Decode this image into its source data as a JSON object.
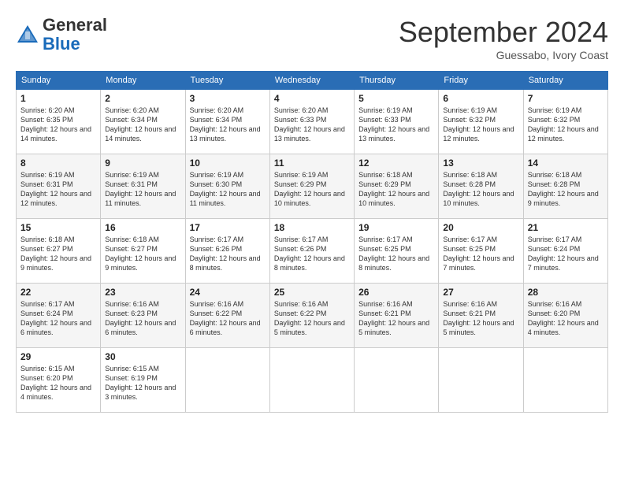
{
  "header": {
    "logo_general": "General",
    "logo_blue": "Blue",
    "month_title": "September 2024",
    "location": "Guessabo, Ivory Coast"
  },
  "days_of_week": [
    "Sunday",
    "Monday",
    "Tuesday",
    "Wednesday",
    "Thursday",
    "Friday",
    "Saturday"
  ],
  "weeks": [
    [
      {
        "day": "1",
        "sunrise": "6:20 AM",
        "sunset": "6:35 PM",
        "daylight": "12 hours and 14 minutes."
      },
      {
        "day": "2",
        "sunrise": "6:20 AM",
        "sunset": "6:34 PM",
        "daylight": "12 hours and 14 minutes."
      },
      {
        "day": "3",
        "sunrise": "6:20 AM",
        "sunset": "6:34 PM",
        "daylight": "12 hours and 13 minutes."
      },
      {
        "day": "4",
        "sunrise": "6:20 AM",
        "sunset": "6:33 PM",
        "daylight": "12 hours and 13 minutes."
      },
      {
        "day": "5",
        "sunrise": "6:19 AM",
        "sunset": "6:33 PM",
        "daylight": "12 hours and 13 minutes."
      },
      {
        "day": "6",
        "sunrise": "6:19 AM",
        "sunset": "6:32 PM",
        "daylight": "12 hours and 12 minutes."
      },
      {
        "day": "7",
        "sunrise": "6:19 AM",
        "sunset": "6:32 PM",
        "daylight": "12 hours and 12 minutes."
      }
    ],
    [
      {
        "day": "8",
        "sunrise": "6:19 AM",
        "sunset": "6:31 PM",
        "daylight": "12 hours and 12 minutes."
      },
      {
        "day": "9",
        "sunrise": "6:19 AM",
        "sunset": "6:31 PM",
        "daylight": "12 hours and 11 minutes."
      },
      {
        "day": "10",
        "sunrise": "6:19 AM",
        "sunset": "6:30 PM",
        "daylight": "12 hours and 11 minutes."
      },
      {
        "day": "11",
        "sunrise": "6:19 AM",
        "sunset": "6:29 PM",
        "daylight": "12 hours and 10 minutes."
      },
      {
        "day": "12",
        "sunrise": "6:18 AM",
        "sunset": "6:29 PM",
        "daylight": "12 hours and 10 minutes."
      },
      {
        "day": "13",
        "sunrise": "6:18 AM",
        "sunset": "6:28 PM",
        "daylight": "12 hours and 10 minutes."
      },
      {
        "day": "14",
        "sunrise": "6:18 AM",
        "sunset": "6:28 PM",
        "daylight": "12 hours and 9 minutes."
      }
    ],
    [
      {
        "day": "15",
        "sunrise": "6:18 AM",
        "sunset": "6:27 PM",
        "daylight": "12 hours and 9 minutes."
      },
      {
        "day": "16",
        "sunrise": "6:18 AM",
        "sunset": "6:27 PM",
        "daylight": "12 hours and 9 minutes."
      },
      {
        "day": "17",
        "sunrise": "6:17 AM",
        "sunset": "6:26 PM",
        "daylight": "12 hours and 8 minutes."
      },
      {
        "day": "18",
        "sunrise": "6:17 AM",
        "sunset": "6:26 PM",
        "daylight": "12 hours and 8 minutes."
      },
      {
        "day": "19",
        "sunrise": "6:17 AM",
        "sunset": "6:25 PM",
        "daylight": "12 hours and 8 minutes."
      },
      {
        "day": "20",
        "sunrise": "6:17 AM",
        "sunset": "6:25 PM",
        "daylight": "12 hours and 7 minutes."
      },
      {
        "day": "21",
        "sunrise": "6:17 AM",
        "sunset": "6:24 PM",
        "daylight": "12 hours and 7 minutes."
      }
    ],
    [
      {
        "day": "22",
        "sunrise": "6:17 AM",
        "sunset": "6:24 PM",
        "daylight": "12 hours and 6 minutes."
      },
      {
        "day": "23",
        "sunrise": "6:16 AM",
        "sunset": "6:23 PM",
        "daylight": "12 hours and 6 minutes."
      },
      {
        "day": "24",
        "sunrise": "6:16 AM",
        "sunset": "6:22 PM",
        "daylight": "12 hours and 6 minutes."
      },
      {
        "day": "25",
        "sunrise": "6:16 AM",
        "sunset": "6:22 PM",
        "daylight": "12 hours and 5 minutes."
      },
      {
        "day": "26",
        "sunrise": "6:16 AM",
        "sunset": "6:21 PM",
        "daylight": "12 hours and 5 minutes."
      },
      {
        "day": "27",
        "sunrise": "6:16 AM",
        "sunset": "6:21 PM",
        "daylight": "12 hours and 5 minutes."
      },
      {
        "day": "28",
        "sunrise": "6:16 AM",
        "sunset": "6:20 PM",
        "daylight": "12 hours and 4 minutes."
      }
    ],
    [
      {
        "day": "29",
        "sunrise": "6:15 AM",
        "sunset": "6:20 PM",
        "daylight": "12 hours and 4 minutes."
      },
      {
        "day": "30",
        "sunrise": "6:15 AM",
        "sunset": "6:19 PM",
        "daylight": "12 hours and 3 minutes."
      },
      null,
      null,
      null,
      null,
      null
    ]
  ]
}
